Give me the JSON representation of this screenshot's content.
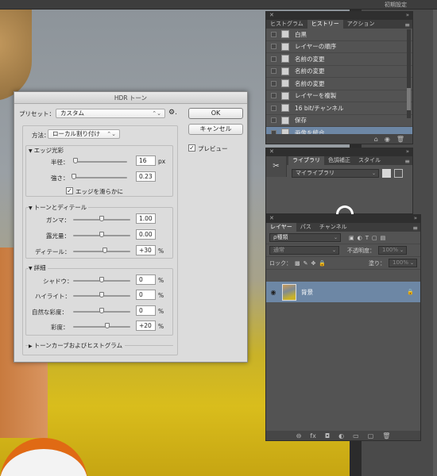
{
  "topbar": {
    "workspace": "初期設定"
  },
  "history_panel": {
    "close": "✕",
    "collapse": "»",
    "tabs": [
      "ヒストグラム",
      "ヒストリー",
      "アクション"
    ],
    "active_tab": 1,
    "menu": "≡",
    "items": [
      "白黒",
      "レイヤーの順序",
      "名前の変更",
      "名前の変更",
      "名前の変更",
      "レイヤーを複製",
      "16 bit/チャンネル",
      "保存",
      "画像を統合"
    ],
    "selected_index": 8,
    "footer_icons": [
      "⌂",
      "◉",
      "🗑"
    ]
  },
  "library_panel": {
    "tabs": [
      "ライブラリ",
      "色調補正",
      "スタイル"
    ],
    "active_tab": 0,
    "dropdown": "マイライブラリ"
  },
  "layers_panel": {
    "tabs": [
      "レイヤー",
      "パス",
      "チャンネル"
    ],
    "active_tab": 0,
    "filter": "ρ種類",
    "blend_mode": "通常",
    "opacity_label": "不透明度：",
    "opacity": "100%",
    "lock_label": "ロック：",
    "fill_label": "塗り：",
    "fill": "100%",
    "layer_name": "背景",
    "footer_icons": [
      "⊖",
      "fx",
      "◘",
      "◐",
      "▭",
      "▢",
      "🗑"
    ]
  },
  "dialog": {
    "title": "HDR トーン",
    "preset_label": "プリセット：",
    "preset_value": "カスタム",
    "method_label": "方法：",
    "method_value": "ローカル割り付け",
    "ok_label": "OK",
    "cancel_label": "キャンセル",
    "preview_label": "プレビュー",
    "preview_checked": true,
    "edge_glow": {
      "title": "エッジ光彩",
      "radius_label": "半径：",
      "radius": "16",
      "radius_unit": "px",
      "strength_label": "強さ：",
      "strength": "0.23",
      "smooth_label": "エッジを滑らかに",
      "smooth_checked": true
    },
    "tone_detail": {
      "title": "トーンとディテール",
      "gamma_label": "ガンマ：",
      "gamma": "1.00",
      "exposure_label": "露光量：",
      "exposure": "0.00",
      "detail_label": "ディテール：",
      "detail": "+30",
      "detail_unit": "%"
    },
    "advanced": {
      "title": "詳細",
      "shadow_label": "シャドウ：",
      "shadow": "0",
      "highlight_label": "ハイライト：",
      "highlight": "0",
      "vibrance_label": "自然な彩度：",
      "vibrance": "0",
      "saturation_label": "彩度：",
      "saturation": "+20",
      "unit": "%"
    },
    "curve_label": "トーンカーブおよびヒストグラム",
    "slider_levels": {
      "radius": 0.05,
      "strength": 0.02,
      "gamma": 0.5,
      "exposure": 0.5,
      "detail": 0.55,
      "shadow": 0.5,
      "highlight": 0.5,
      "vibrance": 0.5,
      "saturation": 0.6
    }
  }
}
